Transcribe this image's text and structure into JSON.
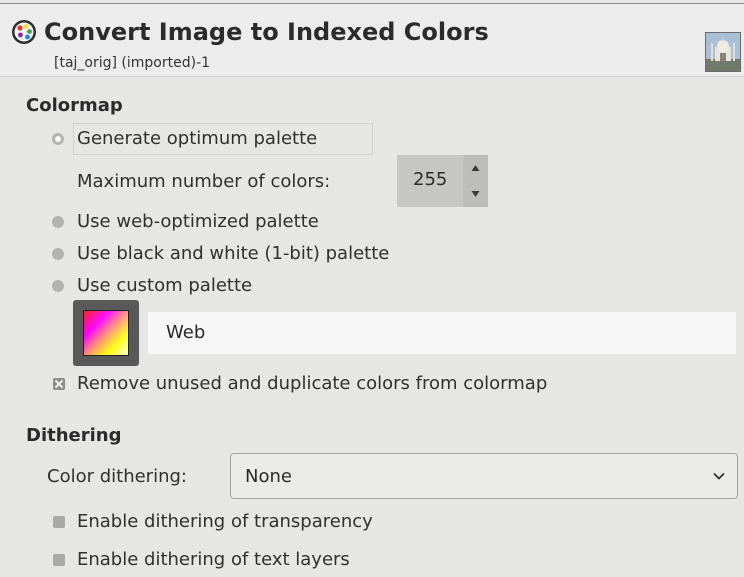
{
  "dialog": {
    "title": "Convert Image to Indexed Colors",
    "subtitle": "[taj_orig] (imported)-1",
    "header_icon": "palette-icon",
    "thumbnail_icon": "image-thumbnail-icon"
  },
  "colormap": {
    "section_title": "Colormap",
    "generate_optimum_label": "Generate optimum palette",
    "max_colors_label": "Maximum number of colors:",
    "max_colors_value": "255",
    "web_optimized_label": "Use web-optimized palette",
    "black_white_label": "Use black and white (1-bit) palette",
    "custom_palette_label": "Use custom palette",
    "custom_palette_name": "Web",
    "remove_unused_label": "Remove unused and duplicate colors from colormap",
    "selected_option": "generate_optimum",
    "remove_unused_checked": true
  },
  "dithering": {
    "section_title": "Dithering",
    "color_dithering_label": "Color dithering:",
    "color_dithering_value": "None",
    "transparency_label": "Enable dithering of transparency",
    "text_layers_label": "Enable dithering of text layers",
    "transparency_checked": false,
    "text_layers_checked": false
  },
  "colors": {
    "background": "#e6e6e5",
    "header_background": "#ececec",
    "text": "#303030",
    "palette_button": "#595959",
    "entry_background": "#f7f7f7"
  }
}
